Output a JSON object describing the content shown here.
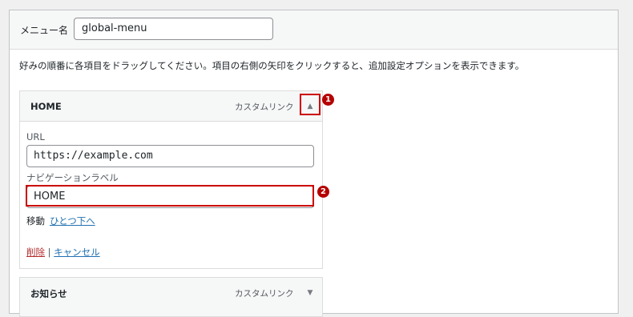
{
  "menu_name": {
    "label": "メニュー名",
    "value": "global-menu"
  },
  "instructions": "好みの順番に各項目をドラッグしてください。項目の右側の矢印をクリックすると、追加設定オプションを表示できます。",
  "items": [
    {
      "title": "HOME",
      "type": "カスタムリンク",
      "toggle": "▲",
      "url_label": "URL",
      "url_value": "https://example.com",
      "nav_label_label": "ナビゲーションラベル",
      "nav_label_value": "HOME",
      "move_label": "移動",
      "move_link": "ひとつ下へ",
      "delete": "削除",
      "separator": "|",
      "cancel": "キャンセル"
    },
    {
      "title": "お知らせ",
      "type": "カスタムリンク",
      "toggle": "▼"
    }
  ],
  "markers": [
    "1",
    "2"
  ],
  "colors": {
    "highlight": "#cc0000",
    "link": "#2271b1",
    "delete": "#b32d2e"
  }
}
